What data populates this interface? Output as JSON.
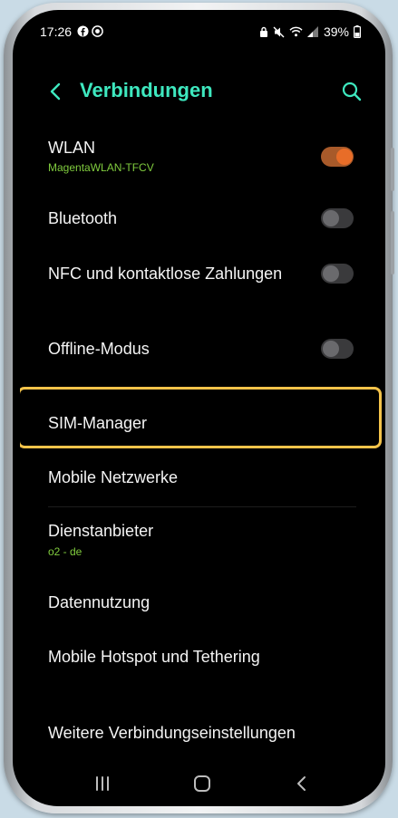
{
  "status_bar": {
    "time": "17:26",
    "battery": "39%",
    "left_icons": [
      "facebook-icon",
      "chat-icon"
    ],
    "right_icons": [
      "lock-icon",
      "mute-icon",
      "wifi-icon",
      "signal-icon",
      "battery-icon"
    ]
  },
  "header": {
    "title": "Verbindungen",
    "back_icon": "chevron-left-icon",
    "search_icon": "search-icon",
    "accent_color": "#3ee8bf"
  },
  "settings": {
    "wlan": {
      "label": "WLAN",
      "sub": "MagentaWLAN-TFCV",
      "enabled": true
    },
    "bluetooth": {
      "label": "Bluetooth",
      "enabled": false
    },
    "nfc": {
      "label": "NFC und kontaktlose Zahlungen",
      "enabled": false
    },
    "offline": {
      "label": "Offline-Modus",
      "enabled": false
    },
    "sim_manager": {
      "label": "SIM-Manager",
      "highlight_color": "#f4c34a"
    },
    "mobile_networks": {
      "label": "Mobile Netzwerke"
    },
    "provider": {
      "label": "Dienstanbieter",
      "sub": "o2 - de"
    },
    "data_usage": {
      "label": "Datennutzung"
    },
    "hotspot": {
      "label": "Mobile Hotspot und Tethering"
    },
    "more": {
      "label": "Weitere Verbindungseinstellungen"
    }
  },
  "nav_bar": {
    "items": [
      "recent-apps-icon",
      "home-icon",
      "back-icon"
    ]
  },
  "colors": {
    "toggle_on": "#e86d28",
    "sub_text": "#80cc3e",
    "background": "#000000"
  }
}
